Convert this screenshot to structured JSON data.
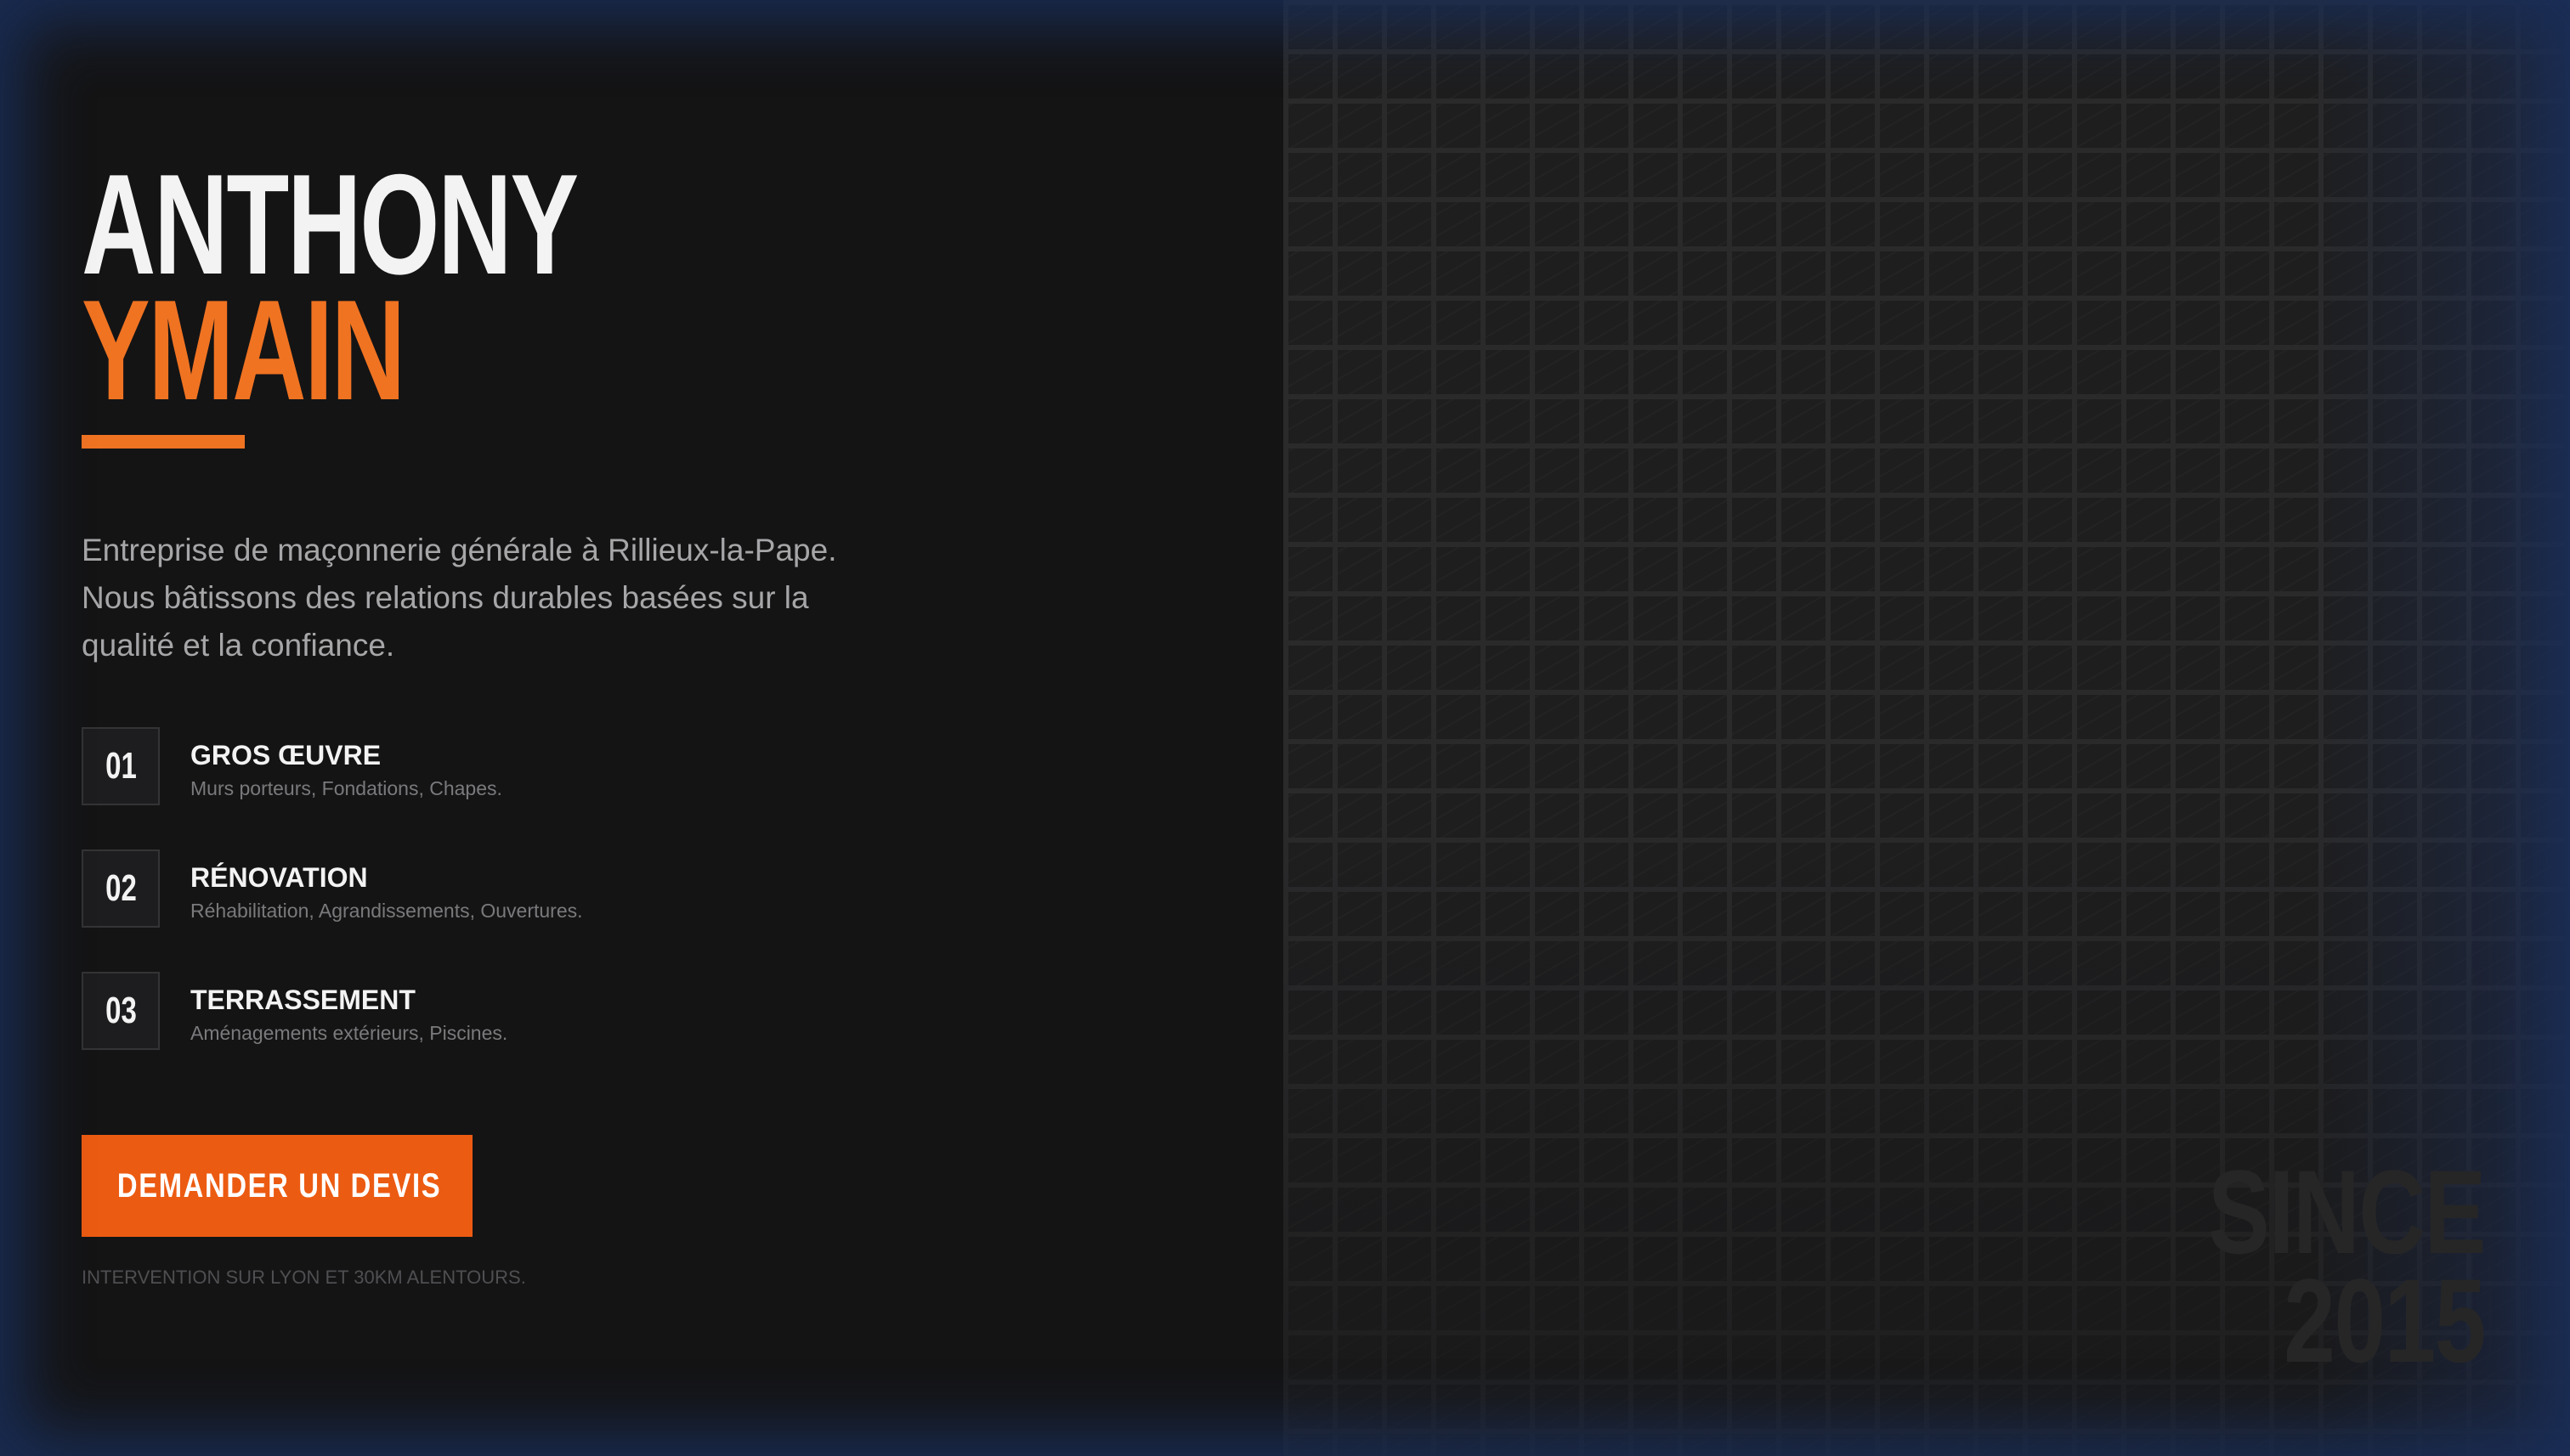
{
  "hero": {
    "name_first": "ANTHONY",
    "name_last": "YMAIN",
    "intro": "Entreprise de maçonnerie générale à Rillieux-la-Pape. Nous bâtissons des relations durables basées sur la qualité et la confiance."
  },
  "services": [
    {
      "number": "01",
      "title": "GROS ŒUVRE",
      "description": "Murs porteurs, Fondations, Chapes."
    },
    {
      "number": "02",
      "title": "RÉNOVATION",
      "description": "Réhabilitation, Agrandissements, Ouvertures."
    },
    {
      "number": "03",
      "title": "TERRASSEMENT",
      "description": "Aménagements extérieurs, Piscines."
    }
  ],
  "cta": {
    "label": "DEMANDER UN DEVIS"
  },
  "footnote": "INTERVENTION SUR LYON ET 30KM ALENTOURS.",
  "watermark": {
    "line1": "SINCE",
    "line2": "2015"
  },
  "colors": {
    "accent": "#f07322",
    "button": "#ec5b12",
    "background": "#141415",
    "frame": "#16243f"
  }
}
